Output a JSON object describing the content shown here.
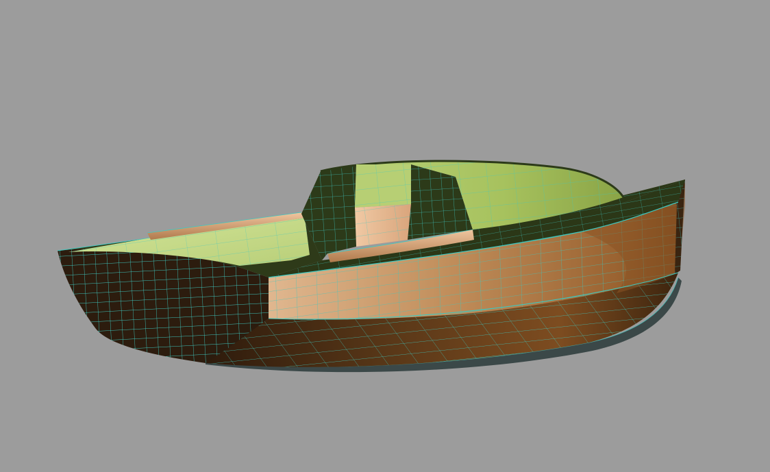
{
  "viewport": {
    "background_color": "#9c9c9c",
    "render_mode": "shaded-with-wireframe"
  },
  "model": {
    "type": "boat-hull",
    "colors": {
      "hull_light": "#c89766",
      "hull_dark": "#3a2612",
      "transom": "#2c1c0e",
      "deck_dark": "#2c3818",
      "cockpit_floor": "#c7db8a",
      "cabin_roof": "#aec766",
      "cabin_side": "#2c3a19",
      "bench": "#e3b48e",
      "wireframe": "#3ec8c0"
    }
  }
}
